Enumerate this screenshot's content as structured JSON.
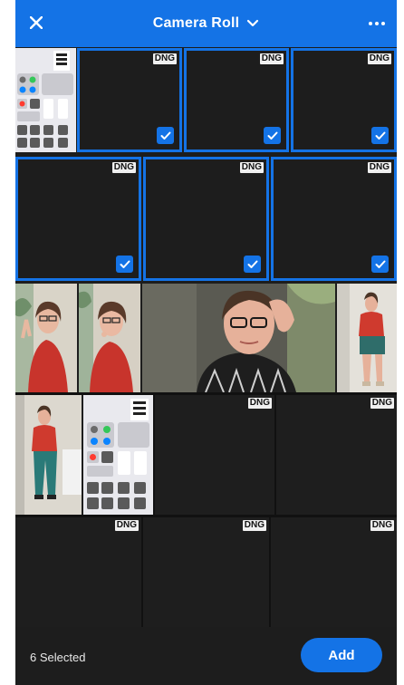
{
  "header": {
    "title": "Camera Roll",
    "close_icon": "close-icon",
    "dropdown_icon": "chevron-down-icon",
    "more_icon": "more-horizontal-icon"
  },
  "badge": {
    "dng": "DNG"
  },
  "footer": {
    "selected_text": "6 Selected",
    "add_label": "Add"
  },
  "grid": {
    "selected_count": 6,
    "cells": [
      {
        "kind": "screenshot",
        "label": ""
      },
      {
        "kind": "dng",
        "selected": true
      },
      {
        "kind": "dng",
        "selected": true
      },
      {
        "kind": "dng",
        "selected": true
      },
      {
        "kind": "dng",
        "selected": true
      },
      {
        "kind": "dng",
        "selected": true
      },
      {
        "kind": "dng",
        "selected": true
      },
      {
        "kind": "photo"
      },
      {
        "kind": "photo"
      },
      {
        "kind": "photo"
      },
      {
        "kind": "photo"
      },
      {
        "kind": "photo"
      },
      {
        "kind": "screenshot"
      },
      {
        "kind": "dng",
        "selected": false
      },
      {
        "kind": "dng",
        "selected": false
      },
      {
        "kind": "dng",
        "selected": false
      },
      {
        "kind": "dng",
        "selected": false
      },
      {
        "kind": "dng",
        "selected": false
      }
    ]
  },
  "colors": {
    "accent": "#1473e6",
    "background": "#1d1d1d",
    "badge": "#f0f0f0"
  }
}
